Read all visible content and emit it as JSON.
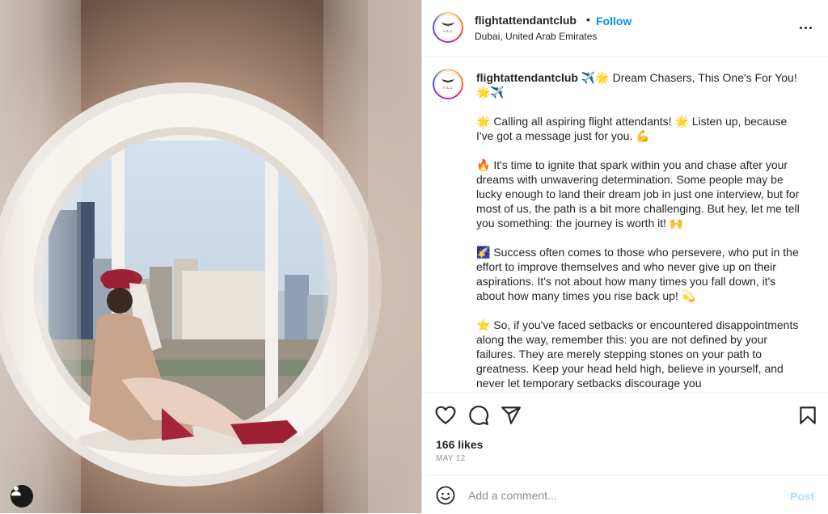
{
  "post": {
    "username": "flightattendantclub",
    "follow_label": "Follow",
    "separator": "•",
    "location": "Dubai, United Arab Emirates",
    "avatar_text": "F.A.C",
    "caption": {
      "headline": " ✈️🌟 Dream Chasers, This One's For You! 🌟✈️",
      "paragraphs": [
        "🌟 Calling all aspiring flight attendants! 🌟 Listen up, because I've got a message just for you. 💪",
        "🔥 It's time to ignite that spark within you and chase after your dreams with unwavering determination. Some people may be lucky enough to land their dream job in just one interview, but for most of us, the path is a bit more challenging. But hey, let me tell you something: the journey is worth it! 🙌",
        "🌠 Success often comes to those who persevere, who put in the effort to improve themselves and who never give up on their aspirations. It's not about how many times you fall down, it's about how many times you rise back up! 💫",
        "⭐ So, if you've faced setbacks or encountered disappointments along the way, remember this: you are not defined by your failures. They are merely stepping stones on your path to greatness. Keep your head held high, believe in yourself, and never let temporary setbacks discourage you"
      ]
    },
    "likes": "166 likes",
    "date": "MAY 12"
  },
  "comment": {
    "placeholder": "Add a comment...",
    "post_label": "Post"
  },
  "icons": {
    "like": "heart-icon",
    "comment": "comment-icon",
    "share": "share-icon",
    "save": "bookmark-icon",
    "emoji": "emoji-icon",
    "more": "more-icon",
    "user": "user-icon"
  },
  "colors": {
    "accent": "#0095f6",
    "post_disabled": "#b3dbff",
    "muted": "#8e8e8e"
  }
}
